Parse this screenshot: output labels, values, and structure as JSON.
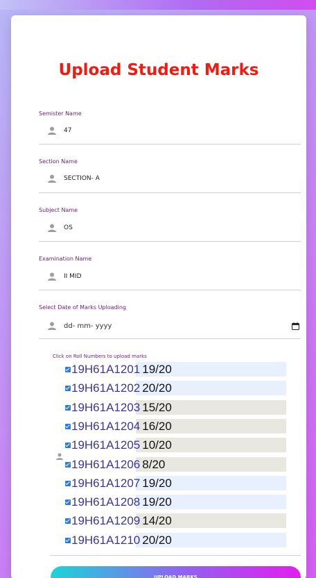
{
  "page": {
    "title": "Upload Student Marks"
  },
  "fields": {
    "semester": {
      "label": "Semister Name",
      "value": "47"
    },
    "section": {
      "label": "Section Name",
      "value": "SECTION- A"
    },
    "subject": {
      "label": "Subject Name",
      "value": "OS"
    },
    "exam": {
      "label": "Examination Name",
      "value": "II MID"
    },
    "date": {
      "label": "Select Date of Marks Uploading",
      "placeholder": "dd- mm- yyyy"
    }
  },
  "roll_section": {
    "label": "Click on Roll Numbers to upload marks",
    "rows": [
      {
        "roll": "19H61A1201",
        "mark": "19/20",
        "checked": true,
        "shade": "blue"
      },
      {
        "roll": "19H61A1202",
        "mark": "20/20",
        "checked": true,
        "shade": "blue"
      },
      {
        "roll": "19H61A1203",
        "mark": "15/20",
        "checked": true,
        "shade": "grey"
      },
      {
        "roll": "19H61A1204",
        "mark": "16/20",
        "checked": true,
        "shade": "grey"
      },
      {
        "roll": "19H61A1205",
        "mark": "10/20",
        "checked": true,
        "shade": "grey"
      },
      {
        "roll": "19H61A1206",
        "mark": "8/20",
        "checked": true,
        "shade": "grey"
      },
      {
        "roll": "19H61A1207",
        "mark": "19/20",
        "checked": true,
        "shade": "blue"
      },
      {
        "roll": "19H61A1208",
        "mark": "19/20",
        "checked": true,
        "shade": "blue"
      },
      {
        "roll": "19H61A1209",
        "mark": "14/20",
        "checked": true,
        "shade": "grey"
      },
      {
        "roll": "19H61A1210",
        "mark": "20/20",
        "checked": true,
        "shade": "blue"
      }
    ]
  },
  "buttons": {
    "upload": "UPLOAD MARKS"
  },
  "colors": {
    "title": "#f51a0f",
    "label": "#6b1b7a",
    "checkbox": "#2f7bd9",
    "row_blue": "#e8f0fe",
    "row_grey": "#e8e8e0",
    "button_gradient": [
      "#1ad5d8",
      "#8b68f0",
      "#e51cf0"
    ]
  },
  "icons": {
    "field": "user-icon",
    "date_picker": "calendar-icon"
  }
}
